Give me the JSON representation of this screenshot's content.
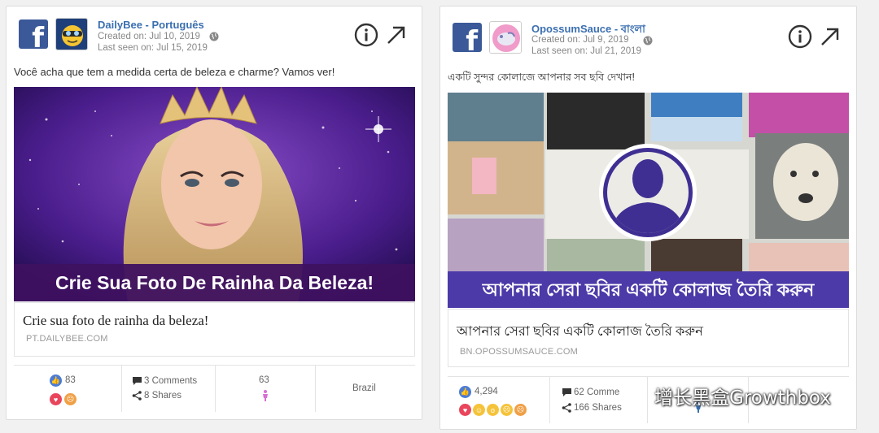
{
  "cards": [
    {
      "page_name": "DailyBee - Português",
      "created": "Created on: Jul 10, 2019",
      "last_seen": "Last seen on: Jul 15, 2019",
      "post_text": "Você acha que tem a medida certa de beleza e charme? Vamos ver!",
      "banner_text": "Crie Sua Foto De Rainha Da Beleza!",
      "link_title": "Crie sua foto de rainha da beleza!",
      "link_domain": "PT.DAILYBEE.COM",
      "likes": "83",
      "comments": "3 Comments",
      "shares": "8 Shares",
      "audience": "63",
      "country": "Brazil",
      "reactions": [
        "like",
        "love",
        "angry"
      ]
    },
    {
      "page_name": "OpossumSauce - বাংলা",
      "created": "Created on: Jul 9, 2019",
      "last_seen": "Last seen on: Jul 21, 2019",
      "post_text": "একটি সুন্দর কোলাজে আপনার সব ছবি দেখান!",
      "banner_text": "আপনার সেরা ছবির একটি কোলাজ তৈরি করুন",
      "link_title": "আপনার সেরা ছবির একটি কোলাজ তৈরি করুন",
      "link_domain": "BN.OPOSSUMSAUCE.COM",
      "likes": "4,294",
      "comments": "62 Comme",
      "shares": "166 Shares",
      "reactions": [
        "love",
        "haha",
        "wow",
        "sad",
        "angry"
      ]
    }
  ],
  "icons": {
    "facebook": "f",
    "info": "info-icon",
    "open": "external-link-icon",
    "globe": "globe-icon",
    "comment": "comment-icon",
    "share": "share-icon",
    "person": "person-icon"
  },
  "watermark": "增长黑盒Growthbox",
  "colors": {
    "facebook_blue": "#3b5998",
    "page_name": "#3b6fb0",
    "banner_a": "#3e1160",
    "banner_b": "#4b3aa8",
    "like": "#4b7cd6",
    "love": "#e9455b",
    "person": "#d86fd6"
  }
}
